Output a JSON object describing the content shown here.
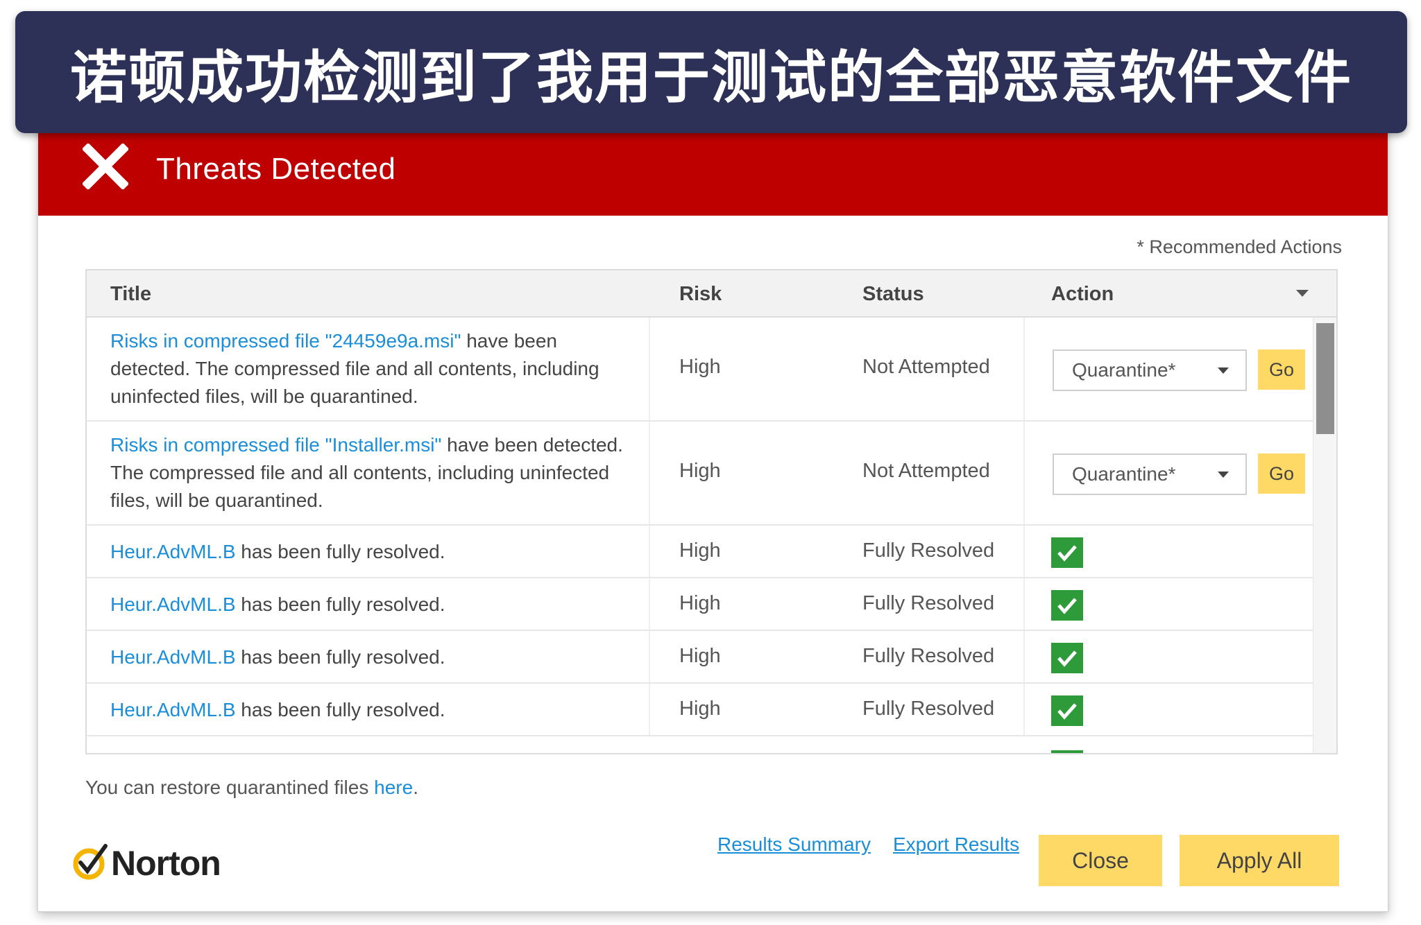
{
  "banner": {
    "text": "诺顿成功检测到了我用于测试的全部恶意软件文件"
  },
  "header": {
    "title": "Threats Detected",
    "icon": "close-x-icon",
    "bg_color": "#be0000"
  },
  "recommended_note": "* Recommended Actions",
  "table": {
    "columns": [
      "Title",
      "Risk",
      "Status",
      "Action"
    ],
    "rows": [
      {
        "title_link": "Risks in compressed file \"24459e9a.msi\"",
        "title_text": " have been detected. The compressed file and all contents, including uninfected files, will be quarantined.",
        "risk": "High",
        "status": "Not Attempted",
        "action": "Quarantine*",
        "go": "Go"
      },
      {
        "title_link": "Risks in compressed file \"Installer.msi\"",
        "title_text": " have been detected. The compressed file and all contents, including uninfected files, will be quarantined.",
        "risk": "High",
        "status": "Not Attempted",
        "action": "Quarantine*",
        "go": "Go"
      },
      {
        "title_link": "Heur.AdvML.B",
        "title_text": "  has been fully resolved.",
        "risk": "High",
        "status": "Fully Resolved"
      },
      {
        "title_link": "Heur.AdvML.B",
        "title_text": "  has been fully resolved.",
        "risk": "High",
        "status": "Fully Resolved"
      },
      {
        "title_link": "Heur.AdvML.B",
        "title_text": "  has been fully resolved.",
        "risk": "High",
        "status": "Fully Resolved"
      },
      {
        "title_link": "Heur.AdvML.B",
        "title_text": "  has been fully resolved.",
        "risk": "High",
        "status": "Fully Resolved"
      }
    ]
  },
  "restore": {
    "text": "You can restore quarantined files ",
    "link": "here",
    "suffix": "."
  },
  "footer": {
    "logo_text": "Norton",
    "results_summary": "Results Summary",
    "export_results": "Export Results",
    "close": "Close",
    "apply_all": "Apply All"
  },
  "colors": {
    "link": "#1a8ed8",
    "button": "#ffd966",
    "check": "#2e9b3a",
    "banner": "#2d3158"
  }
}
